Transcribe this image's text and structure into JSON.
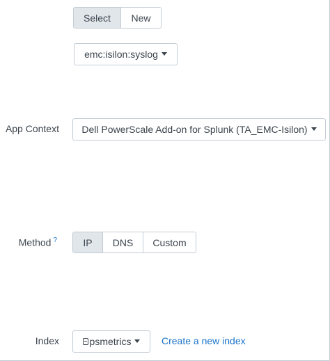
{
  "source_type_toggle": {
    "options": [
      "Select",
      "New"
    ],
    "selected": "Select"
  },
  "source_type_dropdown": {
    "value": "emc:isilon:syslog"
  },
  "app_context": {
    "label": "App Context",
    "value": "Dell PowerScale Add-on for Splunk (TA_EMC-Isilon)"
  },
  "method": {
    "label": "Method",
    "help": "?",
    "options": [
      "IP",
      "DNS",
      "Custom"
    ],
    "selected": "IP"
  },
  "index": {
    "label": "Index",
    "value": "psmetrics",
    "create_link": "Create a new index"
  },
  "colors": {
    "accent": "#1a73c9",
    "active_segment": "#e1e6eb",
    "border": "#c3cbd4",
    "text": "#3c444d"
  }
}
